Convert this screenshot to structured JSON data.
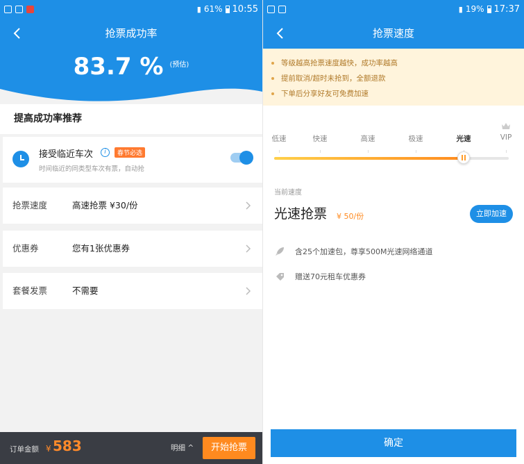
{
  "left": {
    "statusbar": {
      "battery": "61%",
      "time": "10:55"
    },
    "nav": {
      "title": "抢票成功率"
    },
    "hero": {
      "rate": "83.7 %",
      "note": "(预估)"
    },
    "section_title": "提高成功率推荐",
    "accept": {
      "title": "接受临近车次",
      "info": "i",
      "tag": "春节必选",
      "subtitle": "时间临近的同类型车次有票，自动抢",
      "enabled": true
    },
    "rows": [
      {
        "label": "抢票速度",
        "value": "高速抢票 ¥30/份"
      },
      {
        "label": "优惠券",
        "value": "您有1张优惠券"
      },
      {
        "label": "套餐发票",
        "value": "不需要"
      }
    ],
    "bottom": {
      "amount_label": "订单金额",
      "currency": "¥",
      "amount": "583",
      "detail": "明细 ^",
      "start_button": "开始抢票"
    }
  },
  "right": {
    "statusbar": {
      "battery": "19%",
      "time": "17:37"
    },
    "nav": {
      "title": "抢票速度"
    },
    "notices": [
      "等级越高抢票速度越快，成功率越高",
      "提前取消/超时未抢到，全额退款",
      "下单后分享好友可免费加速"
    ],
    "speed_levels": [
      "低速",
      "快速",
      "高速",
      "极速",
      "光速",
      "VIP"
    ],
    "selected_level": "光速",
    "slider_level_index": 4,
    "current_label": "当前速度",
    "current_speed": "光速抢票",
    "current_price": "¥ 50/份",
    "upgrade_button": "立即加速",
    "perks": [
      {
        "icon": "rocket-icon",
        "text": "含25个加速包，尊享500M光速网络通道"
      },
      {
        "icon": "coupon-icon",
        "text": "赠送70元租车优惠券"
      }
    ],
    "confirm_button": "确定"
  },
  "colors": {
    "primary": "#1e8fe6",
    "accent": "#ff8a1f",
    "notice_bg": "#fff4dc",
    "notice_text": "#b07a2a",
    "bottom_bar": "#3a3d44"
  }
}
